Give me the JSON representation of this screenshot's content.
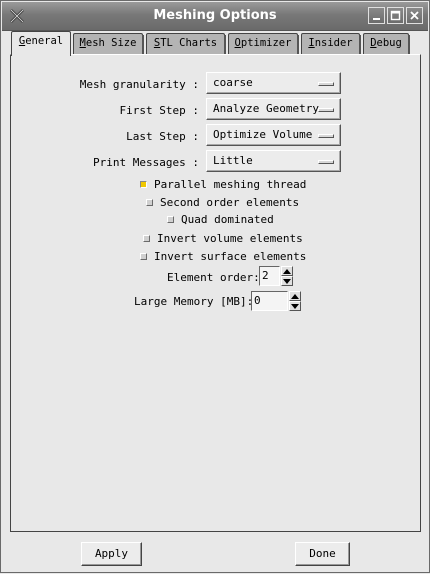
{
  "window": {
    "title": "Meshing Options"
  },
  "tabs": [
    {
      "label": "General",
      "underline": "G",
      "rest": "eneral",
      "active": true
    },
    {
      "label": "Mesh Size",
      "underline": "M",
      "rest": "esh Size"
    },
    {
      "label": "STL Charts",
      "underline": "S",
      "rest": "TL Charts"
    },
    {
      "label": "Optimizer",
      "underline": "O",
      "rest": "ptimizer"
    },
    {
      "label": "Insider",
      "underline": "I",
      "rest": "nsider"
    },
    {
      "label": "Debug",
      "underline": "D",
      "rest": "ebug"
    }
  ],
  "general": {
    "mesh_granularity": {
      "label": "Mesh granularity :",
      "value": "coarse"
    },
    "first_step": {
      "label": "First Step :",
      "value": "Analyze Geometry"
    },
    "last_step": {
      "label": "Last Step :",
      "value": "Optimize Volume"
    },
    "print_messages": {
      "label": "Print Messages :",
      "value": "Little"
    },
    "checks": {
      "parallel": {
        "label": "Parallel meshing thread",
        "checked": true
      },
      "second_order": {
        "label": "Second order elements",
        "checked": false
      },
      "quad": {
        "label": "Quad dominated",
        "checked": false
      },
      "invert_volume": {
        "label": "Invert volume elements",
        "checked": false
      },
      "invert_surface": {
        "label": "Invert surface elements",
        "checked": false
      }
    },
    "element_order": {
      "label": "Element order:",
      "value": "2"
    },
    "large_memory": {
      "label": "Large Memory [MB]:",
      "value": "0"
    }
  },
  "buttons": {
    "apply": "Apply",
    "done": "Done"
  },
  "colors": {
    "titlebar": "#787878",
    "checked": "#f0c800",
    "background": "#e8e8e8"
  }
}
